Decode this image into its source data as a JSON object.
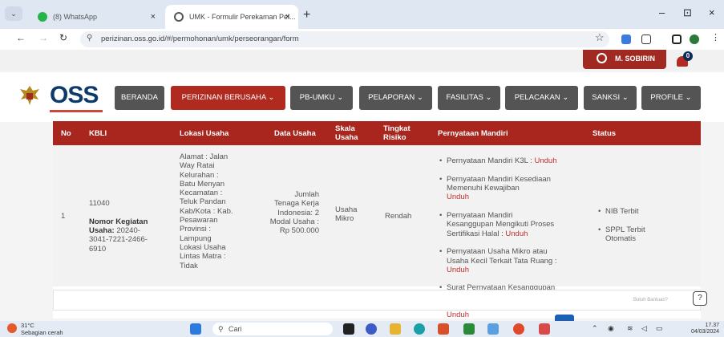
{
  "browser": {
    "tabs": [
      {
        "title": "(8) WhatsApp",
        "close": "×"
      },
      {
        "title": "UMK - Formulir Perekaman Pel...",
        "close": "×"
      }
    ],
    "new_tab": "+",
    "window_controls": {
      "minimize": "–",
      "restore": "⊡",
      "close": "×"
    },
    "url": "perizinan.oss.go.id/#/permohonan/umk/perseorangan/form"
  },
  "site": {
    "user_name": "M. SOBIRIN",
    "notification_count": "0",
    "logo": "OSS",
    "menu": [
      {
        "label": "BERANDA"
      },
      {
        "label": "PERIZINAN BERUSAHA ⌄"
      },
      {
        "label": "PB-UMKU ⌄"
      },
      {
        "label": "PELAPORAN ⌄"
      },
      {
        "label": "FASILITAS ⌄"
      },
      {
        "label": "PELACAKAN ⌄"
      },
      {
        "label": "SANKSI ⌄"
      },
      {
        "label": "PROFILE ⌄"
      }
    ]
  },
  "table": {
    "headers": {
      "no": "No",
      "kbli": "KBLI",
      "lokasi": "Lokasi Usaha",
      "data": "Data Usaha",
      "skala": "Skala\nUsaha",
      "risiko": "Tingkat\nRisiko",
      "pernyataan": "Pernyataan Mandiri",
      "status": "Status"
    },
    "row": {
      "no": "1",
      "kbli_code": "11040",
      "kbli_label": "Nomor Kegiatan\nUsaha:",
      "kbli_value": " 20240-\n3041-7221-2466-\n6910",
      "lokasi": "Alamat : Jalan\nWay Ratai\nKelurahan :\nBatu Menyan\nKecamatan :\nTeluk Pandan\nKab/Kota : Kab.\nPesawaran\nProvinsi :\nLampung\nLokasi Usaha\nLintas Matra :\nTidak",
      "data": "Jumlah\nTenaga Kerja\nIndonesia: 2\nModal Usaha :\nRp 500.000",
      "skala": "Usaha\nMikro",
      "risiko": "Rendah",
      "pernyataan": [
        {
          "text": "Pernyataan Mandiri K3L : ",
          "link": "Unduh"
        },
        {
          "text": "Pernyataan Mandiri Kesediaan\nMemenuhi Kewajiban\n",
          "link": "Unduh"
        },
        {
          "text": "Pernyataan Mandiri\nKesanggupan Mengikuti Proses\nSertifikasi Halal : ",
          "link": "Unduh"
        },
        {
          "text": "Pernyataan Usaha Mikro atau\nUsaha Kecil Terkait Tata Ruang :\n",
          "link": "Unduh"
        },
        {
          "text": "Surat Pernyataan Kesanggupan\nPengelolaan Dan Pemantauan\nLingkungan Hidup (SPPL) :\n",
          "link": "Unduh"
        }
      ],
      "status": [
        "NIB Terbit",
        "SPPL Terbit\nOtomatis"
      ]
    },
    "help_hint": "Butuh Bantuan?"
  },
  "taskbar": {
    "temperature": "31°C",
    "weather": "Sebagian cerah",
    "search": "Cari",
    "time": "17.37",
    "date": "04/03/2024"
  }
}
